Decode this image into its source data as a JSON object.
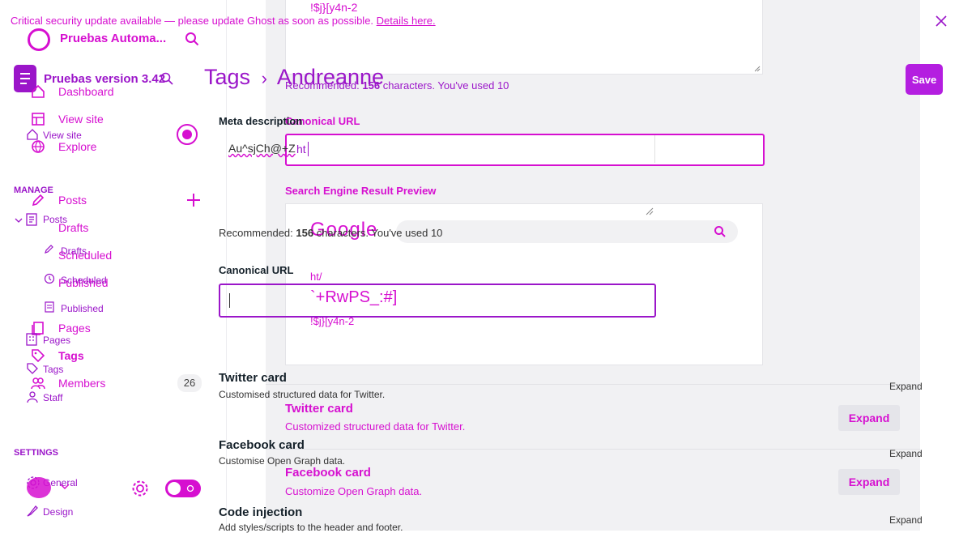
{
  "colors": {
    "accent": "#d60fd0",
    "brand": "#9b16c9",
    "panel": "#f1f1f3"
  },
  "banner": {
    "text": "Critical security update available — please update Ghost as soon as possible.",
    "link": "Details here."
  },
  "sidebar_top": {
    "site_name": "Pruebas Automa...",
    "items": [
      {
        "label": "Dashboard"
      },
      {
        "label": "View site"
      },
      {
        "label": "Explore"
      }
    ],
    "manage_heading": "MANAGE",
    "posts": [
      {
        "label": "Posts"
      },
      {
        "label": "Drafts"
      },
      {
        "label": "Scheduled"
      },
      {
        "label": "Published"
      }
    ],
    "pages": "Pages",
    "tags": "Tags",
    "members": "Members",
    "members_count": "26"
  },
  "sidebar_bottom": {
    "site_name": "Pruebas version 3.42",
    "view_site": "View site",
    "manage_heading": "MANAGE",
    "posts": "Posts",
    "drafts": "Drafts",
    "scheduled": "Scheduled",
    "published": "Published",
    "pages": "Pages",
    "tags": "Tags",
    "staff": "Staff",
    "settings_heading": "SETTINGS",
    "general": "General",
    "design": "Design"
  },
  "header": {
    "breadcrumb_root": "Tags",
    "breadcrumb_current": "Andreanne",
    "save_label": "Save"
  },
  "form_back": {
    "meta_description_label": "Meta description",
    "meta_description_value": "Au^sjCh@+Z",
    "meta_hint_prefix": "Recommended: ",
    "meta_hint_count": "156",
    "meta_hint_suffix": " characters. You've used 10",
    "canonical_label": "Canonical URL",
    "canonical_value": "",
    "twitter_title": "Twitter card",
    "twitter_desc": "Customised structured data for Twitter.",
    "facebook_title": "Facebook card",
    "facebook_desc": "Customise Open Graph data.",
    "code_title": "Code injection",
    "code_desc": "Add styles/scripts to the header and footer.",
    "expand_label": "Expand"
  },
  "form_front": {
    "top_value": "!$j}[y4n-2",
    "hint_prefix": "Recommended: ",
    "hint_count": "156",
    "hint_suffix": " characters. You've used 10",
    "canonical_label": "Canonical URL",
    "canonical_value": "ht",
    "serp_label": "Search Engine Result Preview",
    "google": "Google",
    "serp_url": "ht/",
    "serp_title": "`+RwPS_:#]",
    "serp_desc": "!$j}[y4n-2",
    "twitter_title": "Twitter card",
    "twitter_desc": "Customized structured data for Twitter.",
    "facebook_title": "Facebook card",
    "facebook_desc": "Customize Open Graph data.",
    "expand_label": "Expand"
  }
}
